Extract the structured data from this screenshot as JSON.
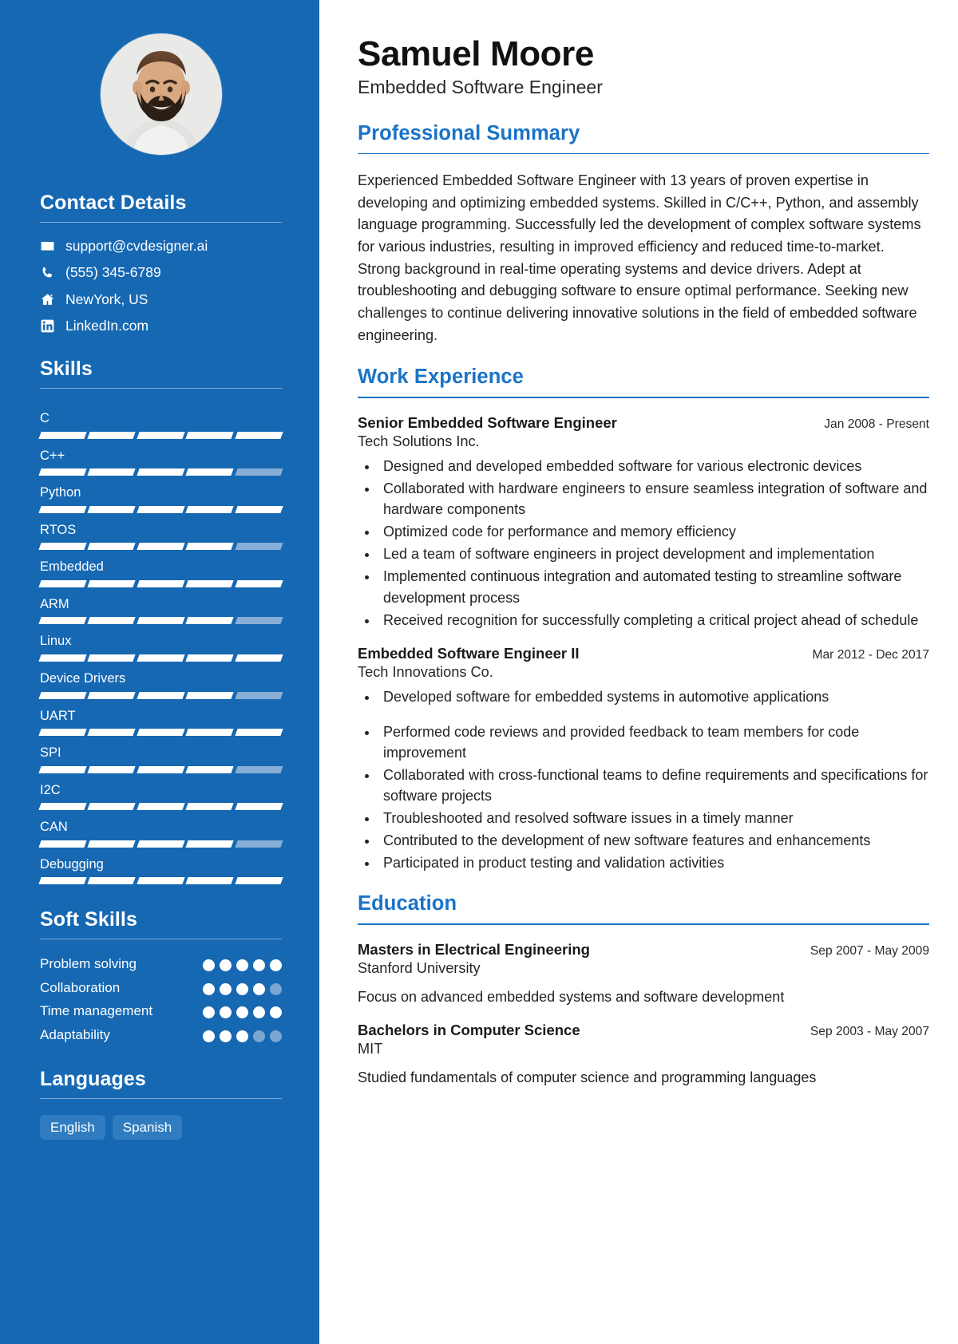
{
  "theme": {
    "sidebar_bg": "#1668b3",
    "accent": "#1a73c7",
    "skill_filled": "#ffffff",
    "skill_empty": "#87aed6",
    "tag_bg": "#2f7cc0"
  },
  "header": {
    "name": "Samuel Moore",
    "role": "Embedded Software Engineer"
  },
  "sidebar": {
    "contact_heading": "Contact Details",
    "contact": [
      {
        "icon": "envelope-icon",
        "value": "support@cvdesigner.ai"
      },
      {
        "icon": "phone-icon",
        "value": "(555) 345-6789"
      },
      {
        "icon": "home-icon",
        "value": "NewYork, US"
      },
      {
        "icon": "linkedin-icon",
        "value": "LinkedIn.com"
      }
    ],
    "skills_heading": "Skills",
    "skills": [
      {
        "name": "C",
        "filled": 5,
        "total": 5
      },
      {
        "name": "C++",
        "filled": 4,
        "total": 5
      },
      {
        "name": "Python",
        "filled": 5,
        "total": 5
      },
      {
        "name": "RTOS",
        "filled": 4,
        "total": 5
      },
      {
        "name": "Embedded",
        "filled": 5,
        "total": 5
      },
      {
        "name": "ARM",
        "filled": 4,
        "total": 5
      },
      {
        "name": "Linux",
        "filled": 5,
        "total": 5
      },
      {
        "name": "Device Drivers",
        "filled": 4,
        "total": 5
      },
      {
        "name": "UART",
        "filled": 5,
        "total": 5
      },
      {
        "name": "SPI",
        "filled": 4,
        "total": 5
      },
      {
        "name": "I2C",
        "filled": 5,
        "total": 5
      },
      {
        "name": "CAN",
        "filled": 4,
        "total": 5
      },
      {
        "name": "Debugging",
        "filled": 5,
        "total": 5
      }
    ],
    "soft_skills_heading": "Soft Skills",
    "soft_skills": [
      {
        "name": "Problem solving",
        "filled": 5,
        "total": 5
      },
      {
        "name": "Collaboration",
        "filled": 4,
        "total": 5
      },
      {
        "name": "Time management",
        "filled": 5,
        "total": 5
      },
      {
        "name": "Adaptability",
        "filled": 3,
        "total": 5
      }
    ],
    "languages_heading": "Languages",
    "languages": [
      "English",
      "Spanish"
    ]
  },
  "main": {
    "summary_heading": "Professional Summary",
    "summary_text": "Experienced Embedded Software Engineer with 13 years of proven expertise in developing and optimizing embedded systems. Skilled in C/C++, Python, and assembly language programming. Successfully led the development of complex software systems for various industries, resulting in improved efficiency and reduced time-to-market. Strong background in real-time operating systems and device drivers. Adept at troubleshooting and debugging software to ensure optimal performance. Seeking new challenges to continue delivering innovative solutions in the field of embedded software engineering.",
    "experience_heading": "Work Experience",
    "experience": [
      {
        "title": "Senior Embedded Software Engineer",
        "date": "Jan 2008 - Present",
        "organization": "Tech Solutions Inc.",
        "bullets": [
          "Designed and developed embedded software for various electronic devices",
          "Collaborated with hardware engineers to ensure seamless integration of software and hardware components",
          "Optimized code for performance and memory efficiency",
          "Led a team of software engineers in project development and implementation",
          "Implemented continuous integration and automated testing to streamline software development process",
          "Received recognition for successfully completing a critical project ahead of schedule"
        ]
      },
      {
        "title": "Embedded Software Engineer II",
        "date": "Mar 2012 - Dec 2017",
        "organization": "Tech Innovations Co.",
        "bullets": [
          "Developed software for embedded systems in automotive applications",
          "",
          "Performed code reviews and provided feedback to team members for code improvement",
          "Collaborated with cross-functional teams to define requirements and specifications for software projects",
          "Troubleshooted and resolved software issues in a timely manner",
          "Contributed to the development of new software features and enhancements",
          "Participated in product testing and validation activities"
        ]
      }
    ],
    "education_heading": "Education",
    "education": [
      {
        "title": "Masters in Electrical Engineering",
        "date": "Sep 2007 - May 2009",
        "organization": "Stanford University",
        "description": "Focus on advanced embedded systems and software development"
      },
      {
        "title": "Bachelors in Computer Science",
        "date": "Sep 2003 - May 2007",
        "organization": "MIT",
        "description": "Studied fundamentals of computer science and programming languages"
      }
    ]
  }
}
